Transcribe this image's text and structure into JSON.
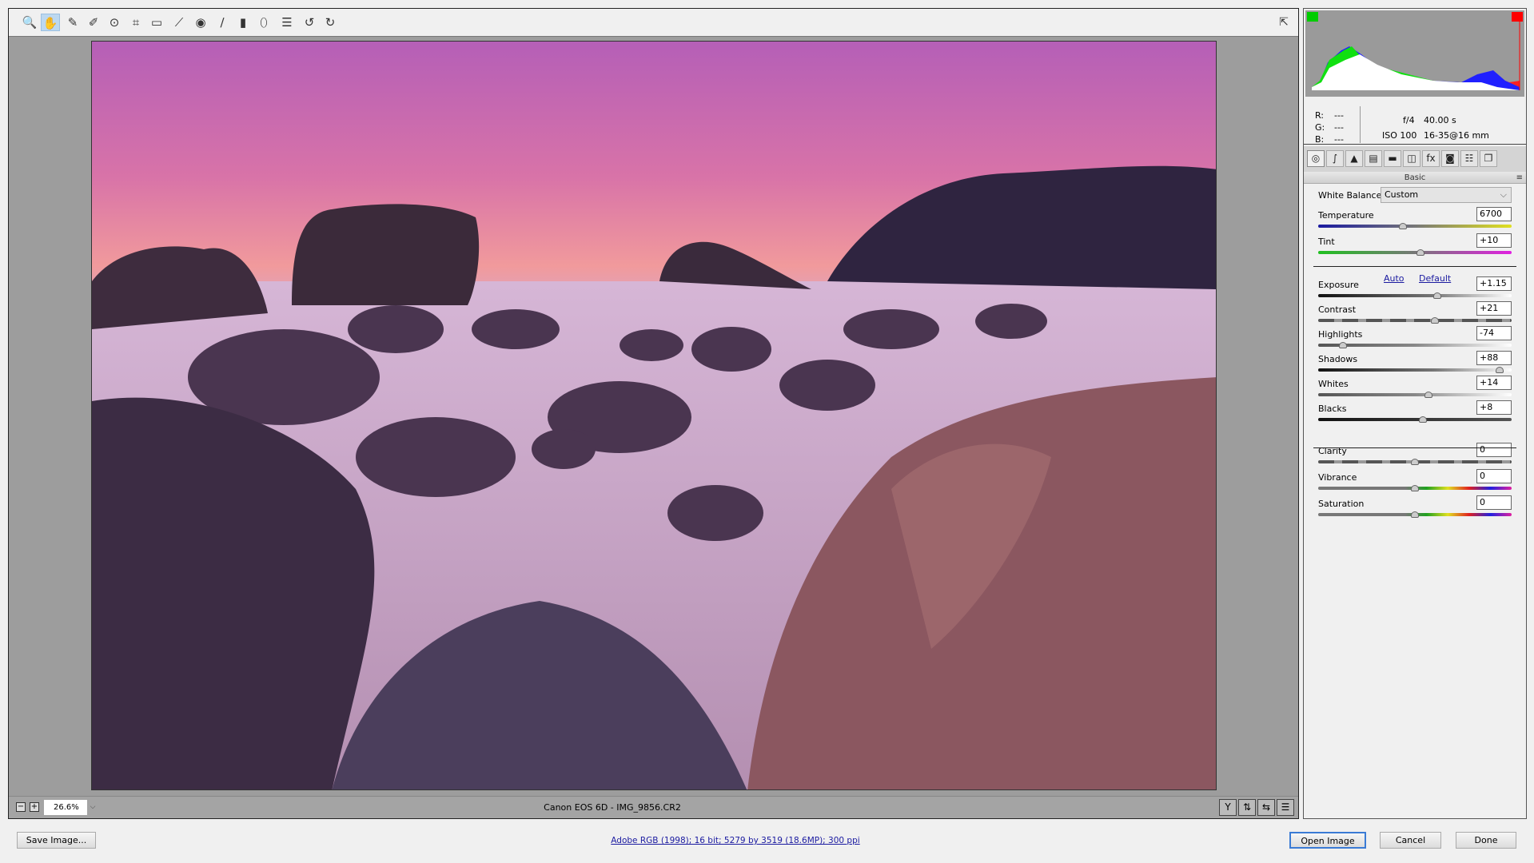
{
  "toolbar": {
    "tools": [
      {
        "name": "zoom-tool",
        "glyph": "🔍"
      },
      {
        "name": "hand-tool",
        "glyph": "✋"
      },
      {
        "name": "white-balance-tool",
        "glyph": "✎"
      },
      {
        "name": "color-sampler-tool",
        "glyph": "✐"
      },
      {
        "name": "targeted-adjustment-tool",
        "glyph": "⊙"
      },
      {
        "name": "crop-tool",
        "glyph": "⌗"
      },
      {
        "name": "straighten-tool",
        "glyph": "▭"
      },
      {
        "name": "spot-removal-tool",
        "glyph": "⟋"
      },
      {
        "name": "red-eye-removal-tool",
        "glyph": "◉"
      },
      {
        "name": "adjustment-brush-tool",
        "glyph": "∕"
      },
      {
        "name": "graduated-filter-tool",
        "glyph": "▮"
      },
      {
        "name": "radial-filter-tool",
        "glyph": "⬯"
      },
      {
        "name": "preferences-tool",
        "glyph": "☰"
      },
      {
        "name": "rotate-left-tool",
        "glyph": "↺"
      },
      {
        "name": "rotate-right-tool",
        "glyph": "↻"
      }
    ],
    "active": "hand-tool"
  },
  "status": {
    "zoom": "26.6%",
    "filename": "Canon EOS 6D  -  IMG_9856.CR2"
  },
  "info": {
    "r_label": "R:",
    "g_label": "G:",
    "b_label": "B:",
    "r": "---",
    "g": "---",
    "b": "---",
    "aperture": "f/4",
    "shutter": "40.00 s",
    "iso": "ISO 100",
    "lens": "16-35@16 mm"
  },
  "panel": {
    "title": "Basic",
    "tabs": [
      "basic",
      "tone-curve",
      "detail",
      "hsl",
      "split-toning",
      "lens-corrections",
      "effects",
      "camera-calibration",
      "presets",
      "snapshots"
    ],
    "white_balance_label": "White Balance:",
    "white_balance": "Custom",
    "auto": "Auto",
    "default": "Default",
    "sliders": [
      {
        "label": "Temperature",
        "value": "6700",
        "position": 0.44,
        "track": "temp"
      },
      {
        "label": "Tint",
        "value": "+10",
        "position": 0.53,
        "track": "tint"
      },
      {
        "label": "Exposure",
        "value": "+1.15",
        "position": 0.615,
        "track": "bw"
      },
      {
        "label": "Contrast",
        "value": "+21",
        "position": 0.605,
        "track": "contrast"
      },
      {
        "label": "Highlights",
        "value": "-74",
        "position": 0.13,
        "track": "wb2"
      },
      {
        "label": "Shadows",
        "value": "+88",
        "position": 0.94,
        "track": "bw"
      },
      {
        "label": "Whites",
        "value": "+14",
        "position": 0.57,
        "track": "wb2"
      },
      {
        "label": "Blacks",
        "value": "+8",
        "position": 0.54,
        "track": "dark"
      },
      {
        "label": "Clarity",
        "value": "0",
        "position": 0.5,
        "track": "contrast"
      },
      {
        "label": "Vibrance",
        "value": "0",
        "position": 0.5,
        "track": "color"
      },
      {
        "label": "Saturation",
        "value": "0",
        "position": 0.5,
        "track": "color"
      }
    ]
  },
  "footer": {
    "save": "Save Image...",
    "workflow": "Adobe RGB (1998); 16 bit; 5279 by 3519 (18.6MP); 300 ppi",
    "open": "Open Image",
    "cancel": "Cancel",
    "done": "Done"
  }
}
